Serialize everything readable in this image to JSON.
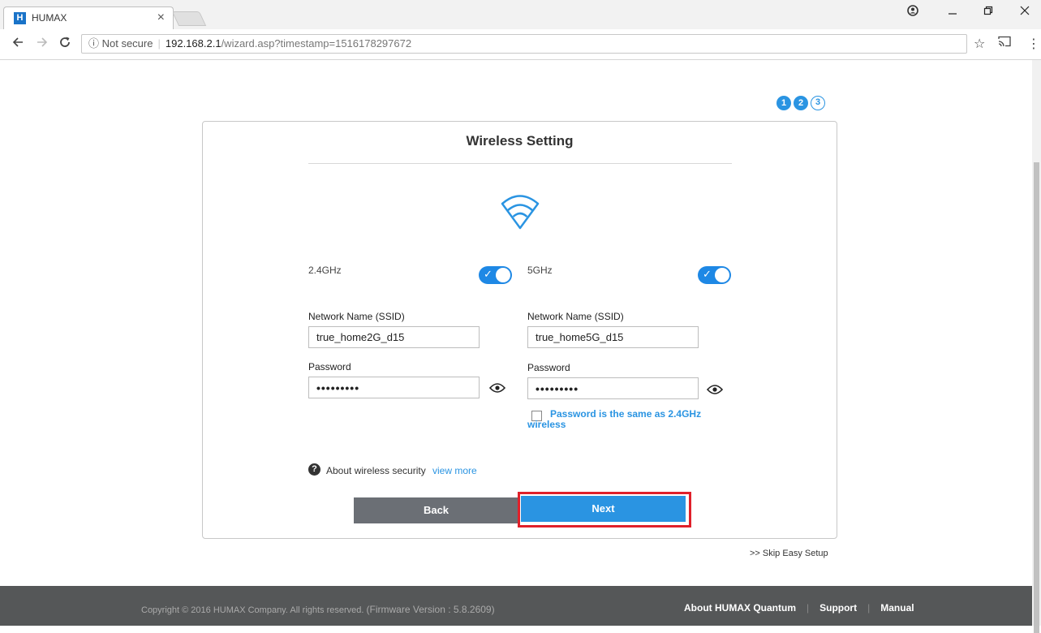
{
  "browser": {
    "tab_title": "HUMAX",
    "tab_favicon": "H",
    "tab_close": "×",
    "security_label": "ⓘ Not secure",
    "url_host": "192.168.2.1",
    "url_path": "/wizard.asp?timestamp=1516178297672",
    "icons": [
      "back-arrow-icon",
      "forward-arrow-icon",
      "reload-icon",
      "star-icon",
      "cast-icon",
      "menu-icon",
      "profile-icon",
      "minimize-icon",
      "maximize-icon",
      "close-icon"
    ]
  },
  "wizard": {
    "steps": [
      "1",
      "2",
      "3"
    ],
    "current_step": 2,
    "title": "Wireless Setting",
    "accent_color": "#2a94e2",
    "band_24": {
      "label": "2.4GHz",
      "enabled": true,
      "ssid_label": "Network Name (SSID)",
      "ssid_value": "true_home2G_d15",
      "password_label": "Password",
      "password_value": "•••••••••"
    },
    "band_5": {
      "label": "5GHz",
      "enabled": true,
      "ssid_label": "Network Name (SSID)",
      "ssid_value": "true_home5G_d15",
      "password_label": "Password",
      "password_value": "•••••••••"
    },
    "same_password_label": "Password is the same as 2.4GHz wireless",
    "same_password_checked": false,
    "help_icon": "?",
    "help_text": "About wireless security",
    "help_link": "view more",
    "back_label": "Back",
    "next_label": "Next",
    "skip_label": ">> Skip Easy Setup"
  },
  "footer": {
    "copyright": "Copyright © 2016 HUMAX Company. All rights reserved.",
    "firmware": "(Firmware Version : 5.8.2609)",
    "links": [
      "About HUMAX Quantum",
      "Support",
      "Manual"
    ],
    "separator": "|"
  }
}
